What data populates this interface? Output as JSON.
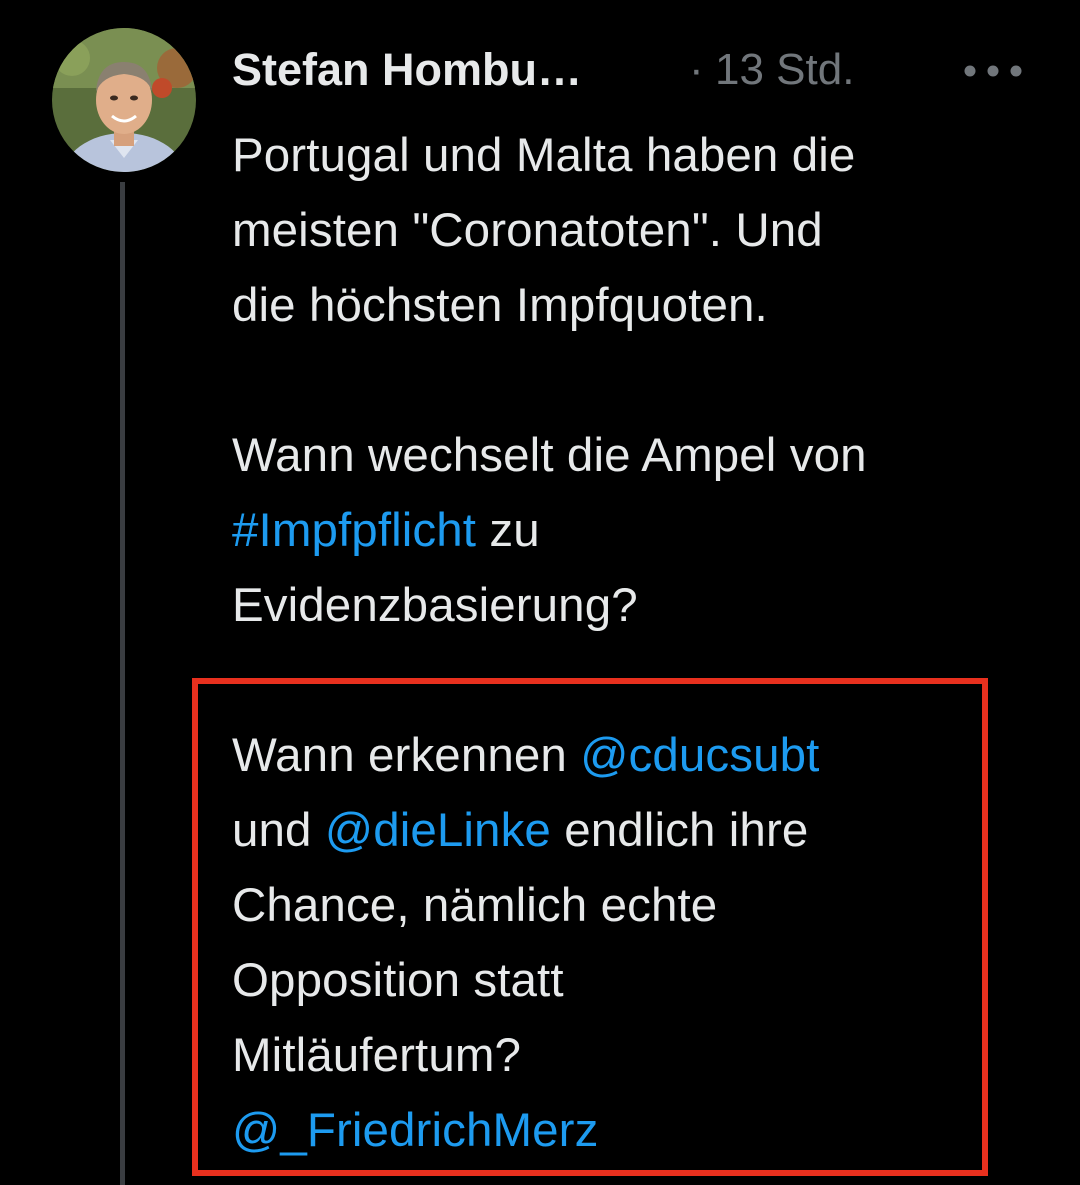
{
  "tweet": {
    "author_name": "Stefan Hombu…",
    "separator": "·",
    "time": "13 Std.",
    "more_icon": "more-horizontal-icon",
    "paragraphs": [
      [
        "Portugal und Malta haben die",
        "meisten \"Coronatoten\". Und",
        "die höchsten Impfquoten."
      ],
      [
        "Wann wechselt die Ampel von",
        "zu",
        "Evidenzbasierung?"
      ],
      [
        "Wann erkennen",
        "und",
        "endlich ihre",
        "Chance, nämlich echte",
        "Opposition statt",
        "Mitläufertum?"
      ]
    ],
    "hashtag": "#Impfpflicht",
    "mentions": [
      "@cducsubt",
      "@dieLinke",
      "@_FriedrichMerz"
    ]
  },
  "colors": {
    "background": "#000000",
    "text": "#e7e9ea",
    "muted": "#71767b",
    "link": "#1d9bf0",
    "highlight_border": "#e8301e"
  }
}
